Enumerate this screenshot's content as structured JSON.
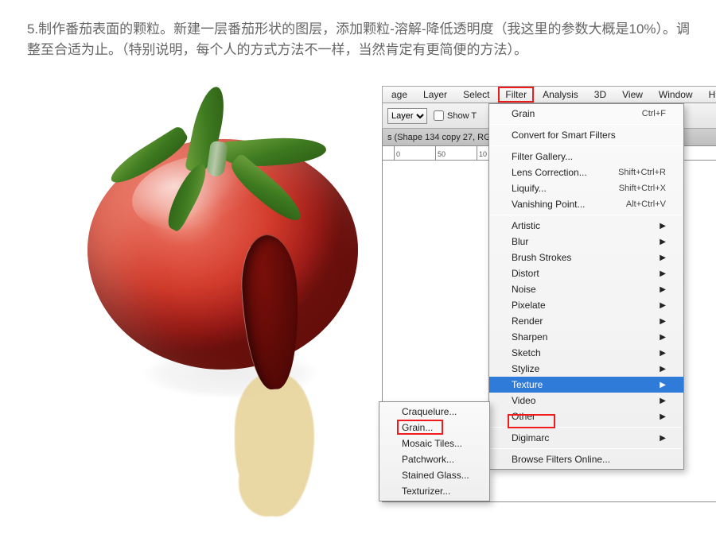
{
  "instruction": "5.制作番茄表面的颗粒。新建一层番茄形状的图层，添加颗粒-溶解-降低透明度（我这里的参数大概是10%）。调整至合适为止。（特别说明，每个人的方式方法不一样，当然肯定有更简便的方法）。",
  "menubar": {
    "image_frag": "age",
    "layer": "Layer",
    "select": "Select",
    "filter": "Filter",
    "analysis": "Analysis",
    "threeD": "3D",
    "view": "View",
    "window": "Window",
    "help_frag": "H"
  },
  "optbar": {
    "layer_label": "Layer",
    "showt": "Show T"
  },
  "tab": "s (Shape 134 copy 27, RG",
  "ruler": {
    "t0": "0",
    "t1": "50",
    "t2": "10"
  },
  "filter_menu": {
    "last": {
      "label": "Grain",
      "shortcut": "Ctrl+F"
    },
    "convert": "Convert for Smart Filters",
    "gallery": "Filter Gallery...",
    "lens": {
      "label": "Lens Correction...",
      "shortcut": "Shift+Ctrl+R"
    },
    "liquify": {
      "label": "Liquify...",
      "shortcut": "Shift+Ctrl+X"
    },
    "vanish": {
      "label": "Vanishing Point...",
      "shortcut": "Alt+Ctrl+V"
    },
    "groups": {
      "artistic": "Artistic",
      "blur": "Blur",
      "brush": "Brush Strokes",
      "distort": "Distort",
      "noise": "Noise",
      "pixelate": "Pixelate",
      "render": "Render",
      "sharpen": "Sharpen",
      "sketch": "Sketch",
      "stylize": "Stylize",
      "texture": "Texture",
      "video": "Video",
      "other": "Other"
    },
    "digimarc": "Digimarc",
    "browse": "Browse Filters Online..."
  },
  "texture_menu": {
    "craquelure": "Craquelure...",
    "grain": "Grain...",
    "mosaic": "Mosaic Tiles...",
    "patchwork": "Patchwork...",
    "stained": "Stained Glass...",
    "texturizer": "Texturizer..."
  },
  "highlights": {
    "filter": "Filter",
    "texture": "Texture",
    "grain": "Grain..."
  }
}
